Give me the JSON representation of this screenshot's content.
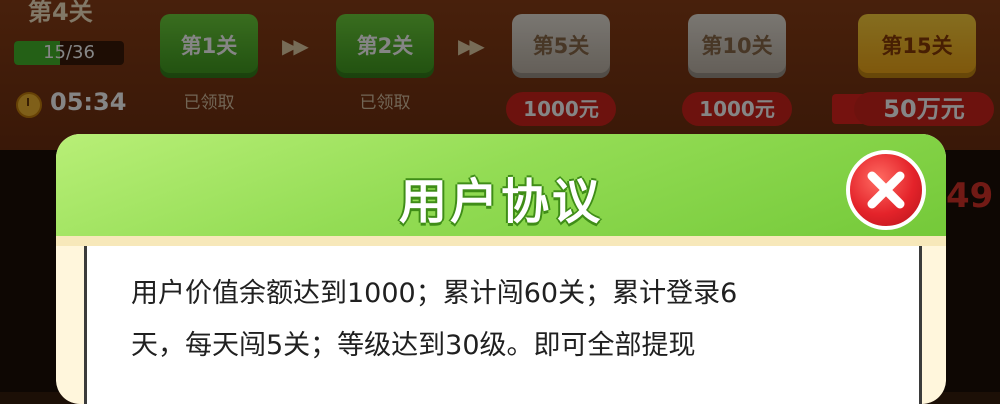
{
  "background": {
    "level_title": "第4关",
    "progress_text": "15/36",
    "progress_fraction": 0.417,
    "timer": "05:34",
    "stages": [
      {
        "label": "第1关",
        "status": "已领取"
      },
      {
        "label": "第2关",
        "status": "已领取"
      },
      {
        "label": "第5关",
        "reward": "1000元"
      },
      {
        "label": "第10关",
        "reward": "1000元"
      },
      {
        "label": "第15关",
        "reward": "50万元"
      }
    ],
    "side_peek": "49"
  },
  "modal": {
    "title": "用户协议",
    "body_line1": "用户价值余额达到1000；累计闯60关；累计登录6",
    "body_line2": "天，每天闯5关；等级达到30级。即可全部提现"
  },
  "colors": {
    "header_green": "#93dc54",
    "close_red": "#e4232a",
    "reward_red": "#d2241c"
  }
}
